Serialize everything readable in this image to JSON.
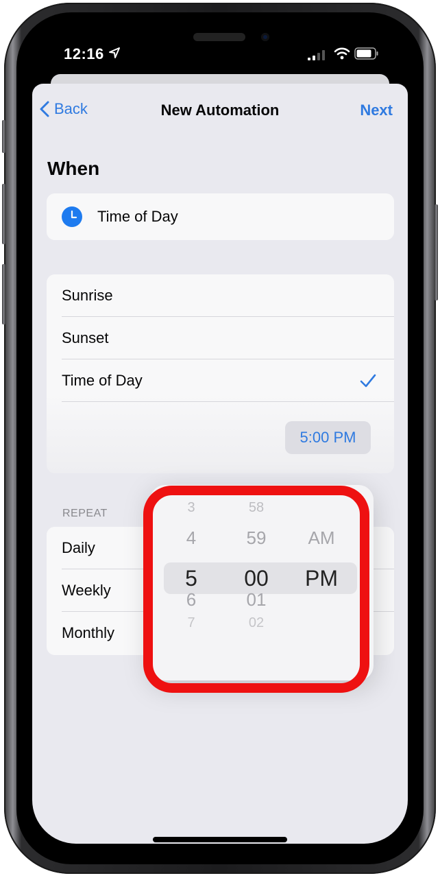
{
  "status_bar": {
    "time": "12:16",
    "icons": [
      "location-arrow-icon",
      "signal-icon",
      "wifi-icon",
      "battery-icon"
    ]
  },
  "nav": {
    "back_label": "Back",
    "title": "New Automation",
    "next_label": "Next"
  },
  "when": {
    "title": "When",
    "trigger": {
      "icon": "clock-icon",
      "label": "Time of Day"
    }
  },
  "options": {
    "items": [
      {
        "label": "Sunrise",
        "selected": false
      },
      {
        "label": "Sunset",
        "selected": false
      },
      {
        "label": "Time of Day",
        "selected": true
      }
    ],
    "time_value": "5:00 PM"
  },
  "repeat": {
    "header": "REPEAT",
    "items": [
      {
        "label": "Daily"
      },
      {
        "label": "Weekly"
      },
      {
        "label": "Monthly"
      }
    ]
  },
  "picker": {
    "hours": [
      "3",
      "4",
      "5",
      "6",
      "7"
    ],
    "minutes": [
      "58",
      "59",
      "00",
      "01",
      "02"
    ],
    "periods": [
      "AM",
      "PM"
    ],
    "selected": {
      "hour": "5",
      "minute": "00",
      "period": "PM"
    }
  },
  "colors": {
    "accent": "#2c7be5",
    "highlight_ring": "#ee1111",
    "background": "#f0f0f5"
  }
}
